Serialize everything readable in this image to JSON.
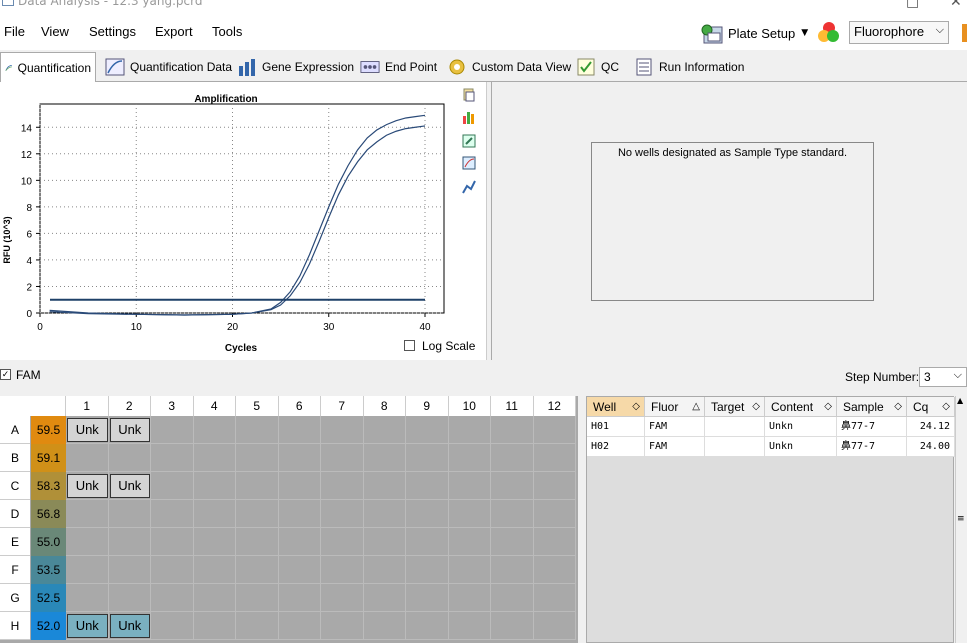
{
  "window": {
    "title": "Data Analysis - 12.3 yang.pcrd"
  },
  "menu": [
    "File",
    "View",
    "Settings",
    "Export",
    "Tools"
  ],
  "toolbar": {
    "plate_setup": "Plate Setup",
    "fluorophore": "Fluorophore"
  },
  "tabs": [
    "Quantification",
    "Quantification Data",
    "Gene Expression",
    "End Point",
    "Custom Data View",
    "QC",
    "Run Information"
  ],
  "chart_data": {
    "type": "line",
    "title": "Amplification",
    "xlabel": "Cycles",
    "ylabel": "RFU (10^3)",
    "xlim": [
      0,
      40
    ],
    "ylim": [
      0,
      15
    ],
    "xticks": [
      0,
      10,
      20,
      30,
      40
    ],
    "yticks": [
      0,
      2,
      4,
      6,
      8,
      10,
      12,
      14
    ],
    "grid": true,
    "threshold": 1.0,
    "series": [
      {
        "x": [
          1,
          5,
          10,
          15,
          20,
          22,
          24,
          25,
          26,
          27,
          28,
          29,
          30,
          31,
          32,
          33,
          34,
          35,
          36,
          37,
          38,
          39,
          40
        ],
        "values": [
          0.2,
          0.0,
          -0.1,
          -0.15,
          -0.1,
          0.0,
          0.3,
          0.8,
          1.6,
          2.8,
          4.4,
          6.2,
          8.0,
          9.7,
          11.1,
          12.3,
          13.2,
          13.8,
          14.2,
          14.5,
          14.7,
          14.8,
          14.9
        ]
      },
      {
        "x": [
          1,
          5,
          10,
          15,
          20,
          22,
          24,
          25,
          26,
          27,
          28,
          29,
          30,
          31,
          32,
          33,
          34,
          35,
          36,
          37,
          38,
          39,
          40
        ],
        "values": [
          0.1,
          -0.05,
          -0.1,
          -0.15,
          -0.1,
          0.0,
          0.25,
          0.6,
          1.3,
          2.3,
          3.7,
          5.4,
          7.2,
          8.9,
          10.3,
          11.4,
          12.3,
          12.9,
          13.4,
          13.7,
          13.9,
          14.0,
          14.1
        ]
      }
    ]
  },
  "log_scale_label": "Log Scale",
  "standard_msg": "No wells designated as Sample Type standard.",
  "fam_label": "FAM",
  "step_label": "Step Number:",
  "step_value": "3",
  "plate": {
    "columns": [
      "1",
      "2",
      "3",
      "4",
      "5",
      "6",
      "7",
      "8",
      "9",
      "10",
      "11",
      "12"
    ],
    "rows": [
      "A",
      "B",
      "C",
      "D",
      "E",
      "F",
      "G",
      "H"
    ],
    "temps": [
      "59.5",
      "59.1",
      "58.3",
      "56.8",
      "55.0",
      "53.5",
      "52.5",
      "52.0"
    ],
    "temp_colors": [
      "#e08a10",
      "#d09018",
      "#b09038",
      "#8a8a58",
      "#6a8878",
      "#4a8898",
      "#2a88b8",
      "#1a88d8"
    ],
    "wells": [
      {
        "row": "A",
        "col": "1",
        "label": "Unk",
        "selected": false
      },
      {
        "row": "A",
        "col": "2",
        "label": "Unk",
        "selected": false
      },
      {
        "row": "C",
        "col": "1",
        "label": "Unk",
        "selected": false
      },
      {
        "row": "C",
        "col": "2",
        "label": "Unk",
        "selected": false
      },
      {
        "row": "H",
        "col": "1",
        "label": "Unk",
        "selected": true
      },
      {
        "row": "H",
        "col": "2",
        "label": "Unk",
        "selected": true
      }
    ]
  },
  "table": {
    "headers": [
      "Well",
      "Fluor",
      "Target",
      "Content",
      "Sample",
      "Cq"
    ],
    "rows": [
      [
        "H01",
        "FAM",
        "",
        "Unkn",
        "鼻77-7",
        "24.12"
      ],
      [
        "H02",
        "FAM",
        "",
        "Unkn",
        "鼻77-7",
        "24.00"
      ]
    ]
  }
}
